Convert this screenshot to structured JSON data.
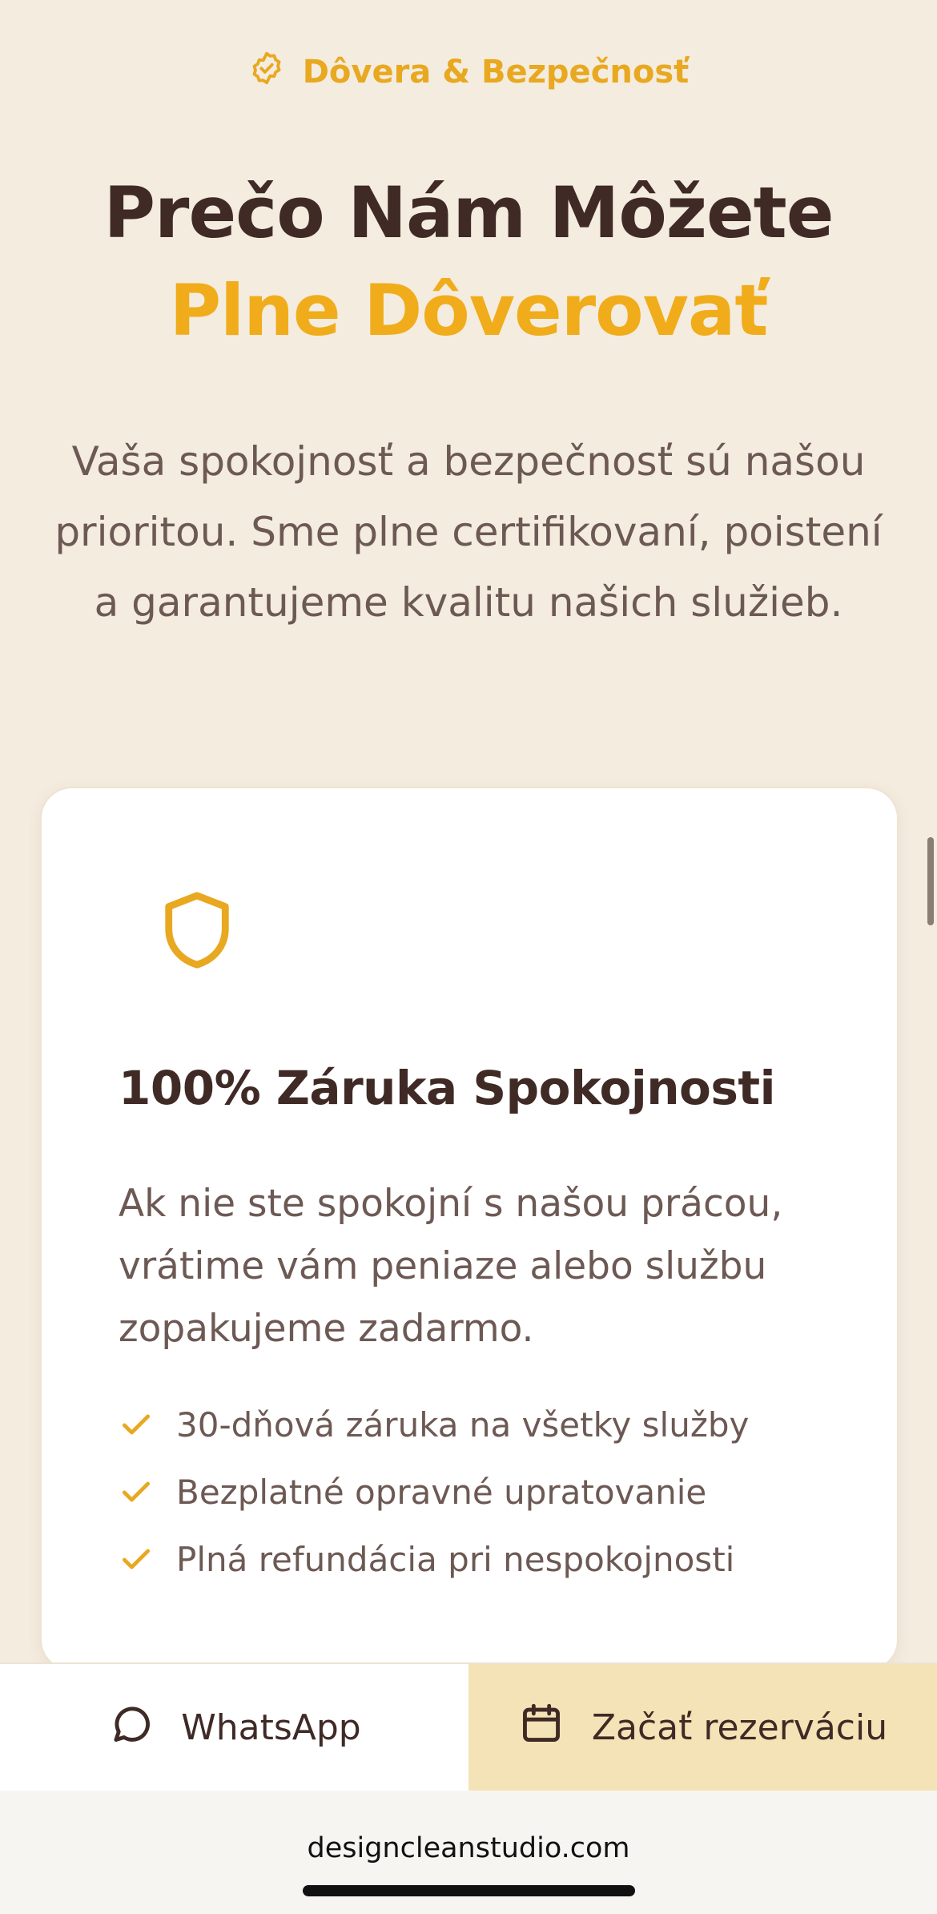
{
  "badge": {
    "icon": "check-badge-icon",
    "label": "Dôvera & Bezpečnosť",
    "color": "#e8a820"
  },
  "headline": {
    "line1": "Prečo Nám Môžete",
    "line2": "Plne Dôverovať"
  },
  "intro": "Vaša spokojnosť a bezpečnosť sú našou prioritou. Sme plne certifikovaní, poistení a garantujeme kvalitu našich služieb.",
  "card": {
    "icon": "shield-icon",
    "title": "100% Záruka Spokojnosti",
    "description": "Ak nie ste spokojní s našou prácou, vrátime vám peniaze alebo službu zopakujeme zadarmo.",
    "features": [
      "30-dňová záruka na všetky služby",
      "Bezplatné opravné upratovanie",
      "Plná refundácia pri nespokojnosti"
    ]
  },
  "actions": {
    "whatsapp": {
      "icon": "chat-bubble-icon",
      "label": "WhatsApp"
    },
    "reserve": {
      "icon": "calendar-icon",
      "label": "Začať rezerváciu"
    }
  },
  "browser": {
    "url": "designcleanstudio.com"
  },
  "colors": {
    "accent": "#f0ac1a",
    "heading": "#3f2a26",
    "background": "#f4ecdf",
    "reserve_bg": "#f4e3b6"
  }
}
